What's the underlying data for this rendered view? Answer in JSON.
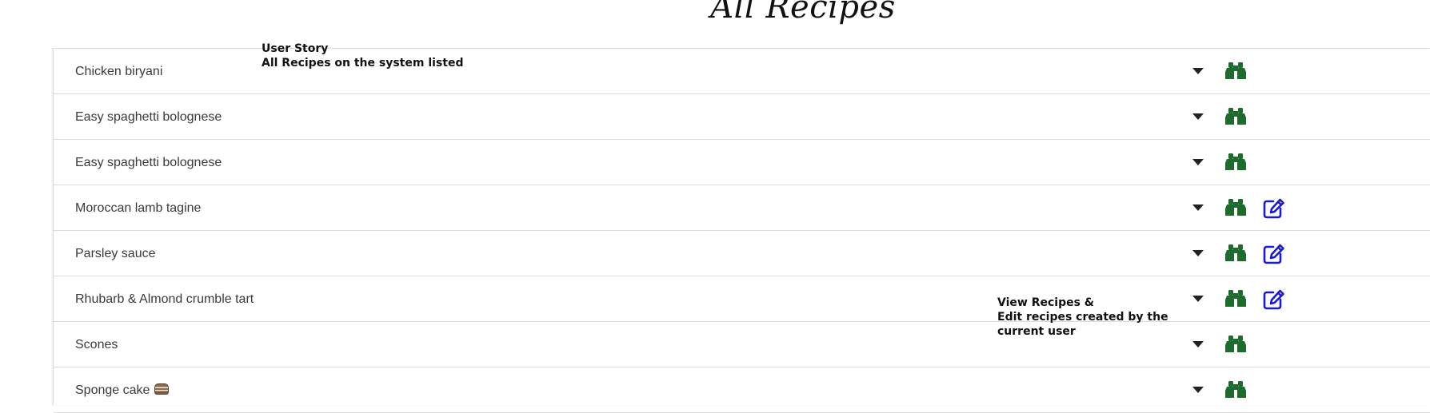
{
  "page": {
    "title": "All Recipes"
  },
  "recipes": [
    {
      "name": "Chicken biryani",
      "editable": false
    },
    {
      "name": "Easy spaghetti bolognese",
      "editable": false
    },
    {
      "name": "Easy spaghetti bolognese",
      "editable": false
    },
    {
      "name": "Moroccan lamb tagine",
      "editable": true
    },
    {
      "name": "Parsley sauce",
      "editable": true
    },
    {
      "name": "Rhubarb & Almond crumble tart",
      "editable": true
    },
    {
      "name": "Scones",
      "editable": false
    },
    {
      "name": "Sponge cake",
      "editable": false,
      "emoji": "cake"
    }
  ],
  "icons": {
    "expand": "caret-down-icon",
    "view": "binoculars-icon",
    "edit": "edit-square-icon"
  },
  "colors": {
    "view_icon": "#1e6b2e",
    "edit_icon": "#1a1ad4",
    "caret": "#222222",
    "divider": "#dcdcdc"
  },
  "annotations": {
    "user_story": {
      "line1": "User Story",
      "line2": "All Recipes on the system listed"
    },
    "view_edit": {
      "line1": "View Recipes &",
      "line2": "Edit recipes created by the",
      "line3": "current user"
    }
  }
}
